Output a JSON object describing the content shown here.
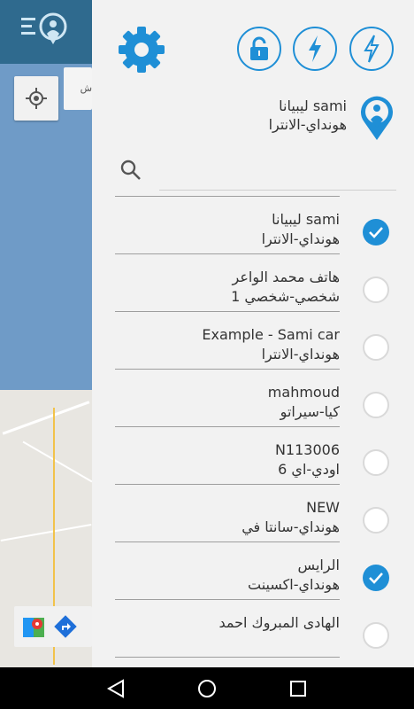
{
  "map": {
    "chip_text": "ش"
  },
  "header": {
    "accent": "#1f8fd6"
  },
  "selected": {
    "name": "ليبيانا sami",
    "model": "هونداي-الانترا"
  },
  "search": {
    "placeholder": ""
  },
  "cars": [
    {
      "name": "",
      "model": "-",
      "checked": false
    },
    {
      "name": "ليبيانا sami",
      "model": "هونداي-الانترا",
      "checked": true
    },
    {
      "name": "هاتف محمد الواعر",
      "model": "شخصي-شخصي 1",
      "checked": false
    },
    {
      "name": "Example - Sami car",
      "model": "هونداي-الانترا",
      "checked": false
    },
    {
      "name": "mahmoud",
      "model": "كيا-سيراتو",
      "checked": false
    },
    {
      "name": "N113006",
      "model": "اودي-اي 6",
      "checked": false
    },
    {
      "name": "NEW",
      "model": "هونداي-سانتا في",
      "checked": false
    },
    {
      "name": "الرايس",
      "model": "هونداي-اكسينت",
      "checked": true
    },
    {
      "name": "الهادى المبروك احمد",
      "model": "",
      "checked": false
    }
  ]
}
